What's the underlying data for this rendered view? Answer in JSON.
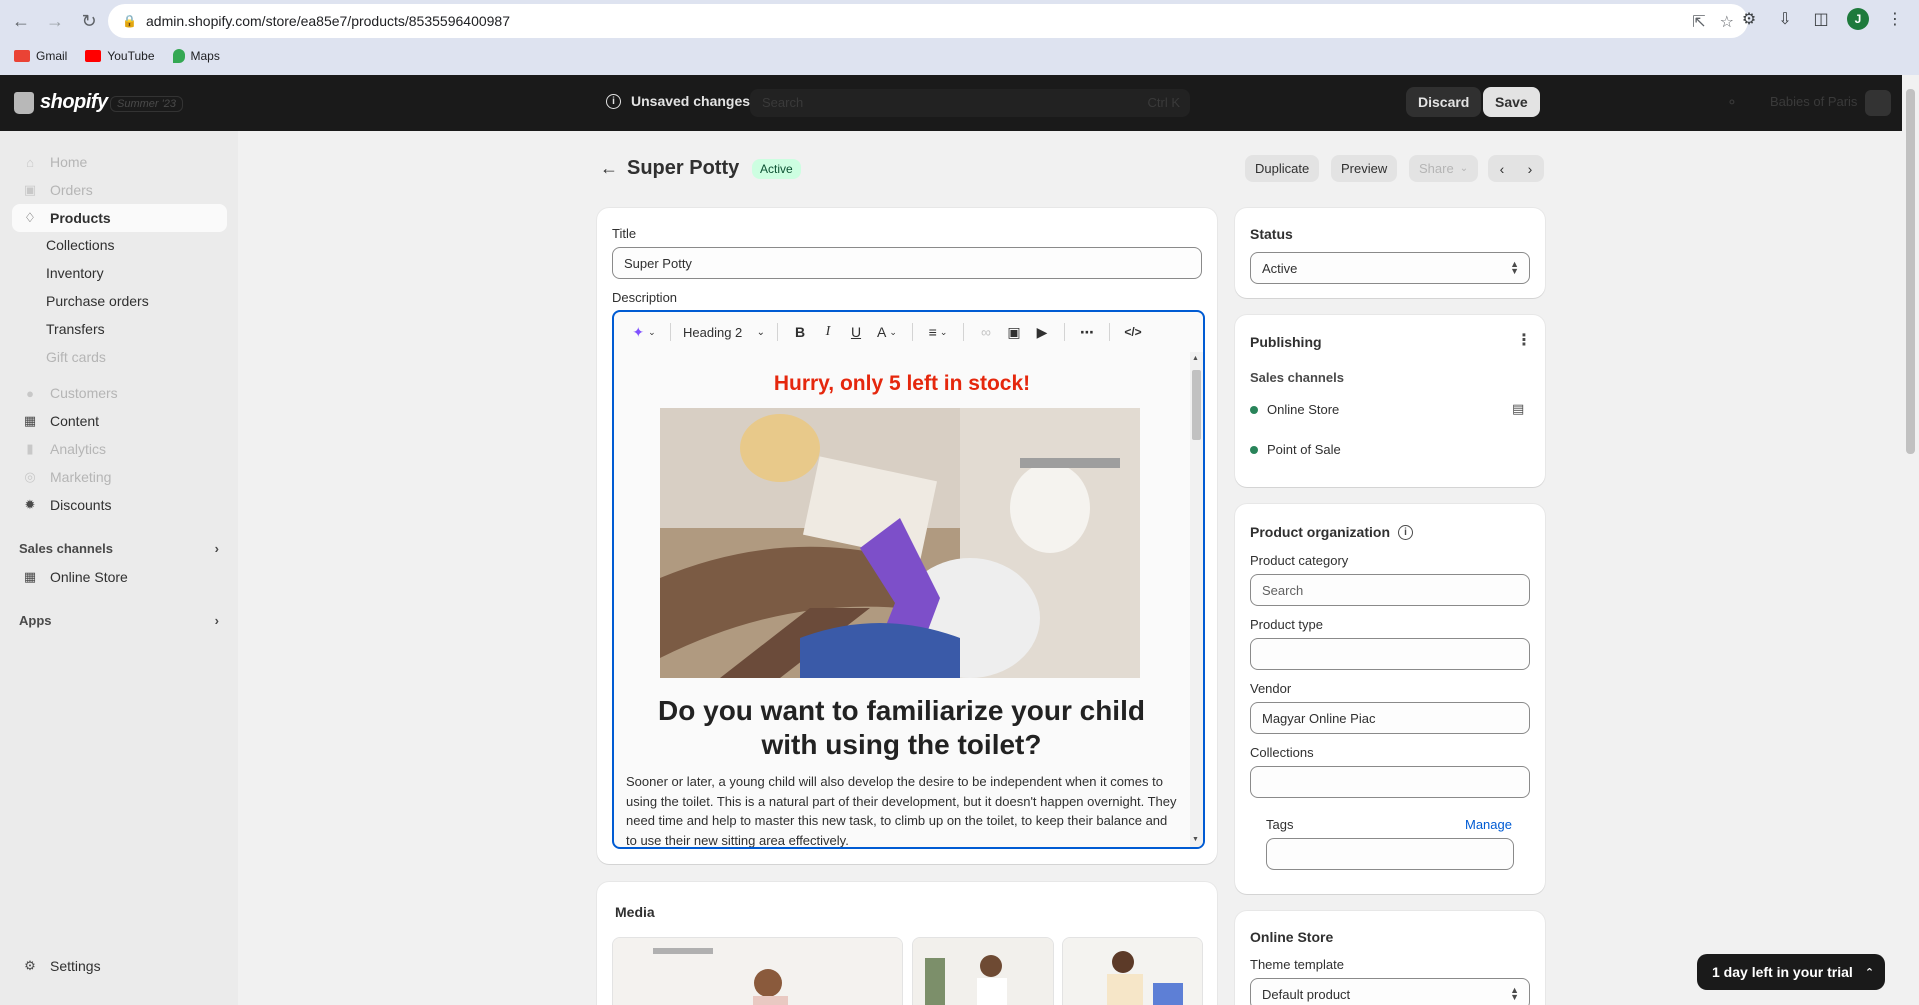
{
  "browser": {
    "url": "admin.shopify.com/store/ea85e7/products/8535596400987",
    "bookmarks": [
      {
        "label": "Gmail",
        "color": "#ea4335"
      },
      {
        "label": "YouTube",
        "color": "#ff0000"
      },
      {
        "label": "Maps",
        "color": "#34a853"
      }
    ],
    "profile_initial": "J"
  },
  "topbar": {
    "logo": "shopify",
    "edition": "Summer '23",
    "unsaved_label": "Unsaved changes",
    "search_placeholder": "Search",
    "search_shortcut": "Ctrl K",
    "discard_label": "Discard",
    "save_label": "Save",
    "store_name": "Babies of Paris"
  },
  "sidebar": {
    "items": {
      "home": "Home",
      "orders": "Orders",
      "products": "Products",
      "collections": "Collections",
      "inventory": "Inventory",
      "purchase_orders": "Purchase orders",
      "transfers": "Transfers",
      "gift_cards": "Gift cards",
      "customers": "Customers",
      "content": "Content",
      "analytics": "Analytics",
      "marketing": "Marketing",
      "discounts": "Discounts",
      "online_store": "Online Store",
      "settings": "Settings"
    },
    "sales_channels_label": "Sales channels",
    "apps_label": "Apps"
  },
  "header": {
    "title": "Super Potty",
    "status_badge": "Active",
    "duplicate_label": "Duplicate",
    "preview_label": "Preview",
    "share_label": "Share"
  },
  "product": {
    "title_label": "Title",
    "title_value": "Super Potty",
    "description_label": "Description",
    "toolbar_style": "Heading 2",
    "description": {
      "stock_alert": "Hurry, only 5 left in stock!",
      "heading": "Do you want to familiarize your child with using the toilet?",
      "paragraph": "Sooner or later, a young child will also develop the desire to be independent when it comes to using the toilet. This is a natural part of their development, but it doesn't happen overnight. They need time and help to master this new task, to climb up on the toilet, to keep their balance and to use their new sitting area effectively."
    },
    "media_label": "Media"
  },
  "status_card": {
    "title": "Status",
    "value": "Active"
  },
  "publishing": {
    "title": "Publishing",
    "sales_channels_label": "Sales channels",
    "channels": [
      "Online Store",
      "Point of Sale"
    ]
  },
  "organization": {
    "title": "Product organization",
    "category_label": "Product category",
    "category_placeholder": "Search",
    "type_label": "Product type",
    "type_value": "",
    "vendor_label": "Vendor",
    "vendor_value": "Magyar Online Piac",
    "collections_label": "Collections",
    "collections_value": "",
    "tags_label": "Tags",
    "tags_manage": "Manage",
    "tags_value": ""
  },
  "online_store_card": {
    "title": "Online Store",
    "theme_label": "Theme template",
    "theme_value": "Default product"
  },
  "trial_banner": "1 day left in your trial",
  "colors": {
    "accent": "#005bd3",
    "stock_alert": "#e5270d",
    "active_badge_bg": "#cdfee1",
    "channel_dot": "#29845a",
    "topbar": "#1a1a1a"
  }
}
